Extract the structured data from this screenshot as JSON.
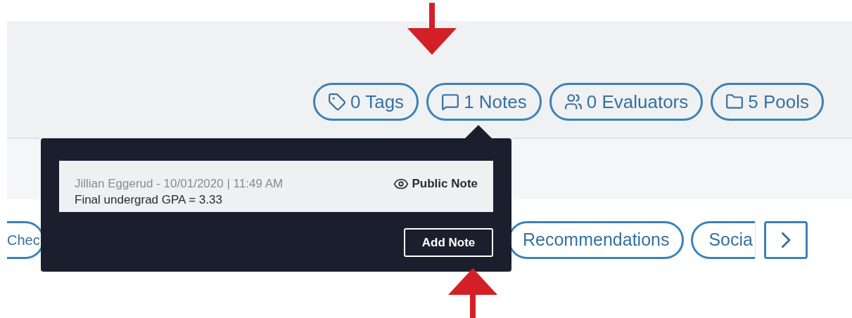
{
  "counters": [
    {
      "kind": "tags",
      "label": "0 Tags"
    },
    {
      "kind": "notes",
      "label": "1 Notes"
    },
    {
      "kind": "evaluators",
      "label": "0 Evaluators"
    },
    {
      "kind": "pools",
      "label": "5 Pools"
    }
  ],
  "notes_popover": {
    "notes": [
      {
        "meta": "Jillian Eggerud - 10/01/2020 | 11:49 AM",
        "visibility": "Public Note",
        "text": "Final undergrad GPA = 3.33"
      }
    ],
    "button": "Add Note"
  },
  "tabs": [
    {
      "label": "Chec"
    },
    {
      "label": "Recommendations"
    },
    {
      "label": "Socia"
    }
  ]
}
